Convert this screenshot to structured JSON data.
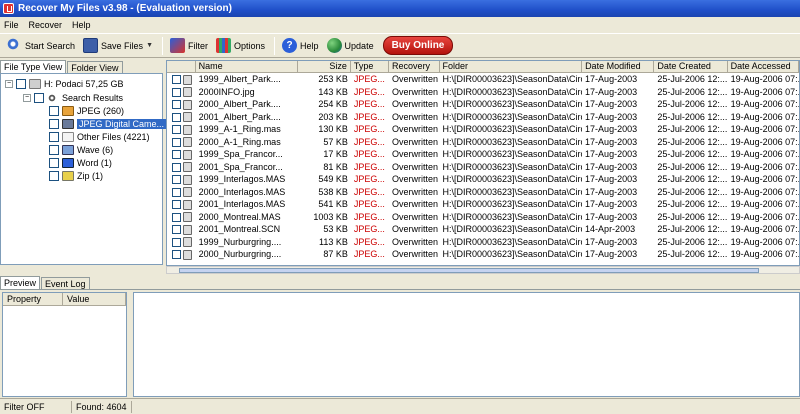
{
  "window": {
    "title": "Recover My Files v3.98  -  (Evaluation version)"
  },
  "menu": [
    "File",
    "Recover",
    "Help"
  ],
  "toolbar": {
    "start_search": "Start Search",
    "save_files": "Save Files",
    "filter": "Filter",
    "options": "Options",
    "help": "Help",
    "update": "Update",
    "buy_online": "Buy Online"
  },
  "left_tabs": [
    "File Type View",
    "Folder View"
  ],
  "tree": {
    "drive": "H: Podaci  57,25 GB",
    "search_results": "Search Results",
    "items": [
      "JPEG (260)",
      "JPEG Digital Came...",
      "Other Files (4221)",
      "Wave (6)",
      "Word (1)",
      "Zip (1)"
    ]
  },
  "list": {
    "columns": [
      "Name",
      "Size",
      "Type",
      "Recovery",
      "Folder",
      "Date Modified",
      "Date Created",
      "Date Accessed"
    ],
    "rows": [
      [
        "1999_Albert_Park....",
        "253 KB",
        "JPEG...",
        "Overwritten",
        "H:\\[DIR00003623]\\SeasonData\\Circ...",
        "17-Aug-2003",
        "25-Jul-2006  12:...",
        "19-Aug-2006  07:..."
      ],
      [
        "2000INFO.jpg",
        "143 KB",
        "JPEG...",
        "Overwritten",
        "H:\\[DIR00003623]\\SeasonData\\Circ...",
        "17-Aug-2003",
        "25-Jul-2006  12:...",
        "19-Aug-2006  07:..."
      ],
      [
        "2000_Albert_Park....",
        "254 KB",
        "JPEG...",
        "Overwritten",
        "H:\\[DIR00003623]\\SeasonData\\Circ...",
        "17-Aug-2003",
        "25-Jul-2006  12:...",
        "19-Aug-2006  07:..."
      ],
      [
        "2001_Albert_Park....",
        "203 KB",
        "JPEG...",
        "Overwritten",
        "H:\\[DIR00003623]\\SeasonData\\Circ...",
        "17-Aug-2003",
        "25-Jul-2006  12:...",
        "19-Aug-2006  07:..."
      ],
      [
        "1999_A-1_Ring.mas",
        "130 KB",
        "JPEG...",
        "Overwritten",
        "H:\\[DIR00003623]\\SeasonData\\Circ...",
        "17-Aug-2003",
        "25-Jul-2006  12:...",
        "19-Aug-2006  07:..."
      ],
      [
        "2000_A-1_Ring.mas",
        "57 KB",
        "JPEG...",
        "Overwritten",
        "H:\\[DIR00003623]\\SeasonData\\Circ...",
        "17-Aug-2003",
        "25-Jul-2006  12:...",
        "19-Aug-2006  07:..."
      ],
      [
        "1999_Spa_Francor...",
        "17 KB",
        "JPEG...",
        "Overwritten",
        "H:\\[DIR00003623]\\SeasonData\\Circ...",
        "17-Aug-2003",
        "25-Jul-2006  12:...",
        "19-Aug-2006  07:..."
      ],
      [
        "2001_Spa_Francor...",
        "81 KB",
        "JPEG...",
        "Overwritten",
        "H:\\[DIR00003623]\\SeasonData\\Circ...",
        "17-Aug-2003",
        "25-Jul-2006  12:...",
        "19-Aug-2006  07:..."
      ],
      [
        "1999_Interlagos.MAS",
        "549 KB",
        "JPEG...",
        "Overwritten",
        "H:\\[DIR00003623]\\SeasonData\\Circ...",
        "17-Aug-2003",
        "25-Jul-2006  12:...",
        "19-Aug-2006  07:..."
      ],
      [
        "2000_Interlagos.MAS",
        "538 KB",
        "JPEG...",
        "Overwritten",
        "H:\\[DIR00003623]\\SeasonData\\Circ...",
        "17-Aug-2003",
        "25-Jul-2006  12:...",
        "19-Aug-2006  07:..."
      ],
      [
        "2001_Interlagos.MAS",
        "541 KB",
        "JPEG...",
        "Overwritten",
        "H:\\[DIR00003623]\\SeasonData\\Circ...",
        "17-Aug-2003",
        "25-Jul-2006  12:...",
        "19-Aug-2006  07:..."
      ],
      [
        "2000_Montreal.MAS",
        "1003 KB",
        "JPEG...",
        "Overwritten",
        "H:\\[DIR00003623]\\SeasonData\\Circ...",
        "17-Aug-2003",
        "25-Jul-2006  12:...",
        "19-Aug-2006  07:..."
      ],
      [
        "2001_Montreal.SCN",
        "53 KB",
        "JPEG...",
        "Overwritten",
        "H:\\[DIR00003623]\\SeasonData\\Circ...",
        "14-Apr-2003",
        "25-Jul-2006  12:...",
        "19-Aug-2006  07:..."
      ],
      [
        "1999_Nurburgring....",
        "113 KB",
        "JPEG...",
        "Overwritten",
        "H:\\[DIR00003623]\\SeasonData\\Circ...",
        "17-Aug-2003",
        "25-Jul-2006  12:...",
        "19-Aug-2006  07:..."
      ],
      [
        "2000_Nurburgring....",
        "87 KB",
        "JPEG...",
        "Overwritten",
        "H:\\[DIR00003623]\\SeasonData\\Circ...",
        "17-Aug-2003",
        "25-Jul-2006  12:...",
        "19-Aug-2006  07:..."
      ]
    ]
  },
  "bottom_tabs": [
    "Preview",
    "Event Log"
  ],
  "properties": {
    "columns": [
      "Property",
      "Value"
    ]
  },
  "status": {
    "filter": "Filter OFF",
    "found": "Found: 4604"
  },
  "colors": {
    "title_bar": "#1f4fc8",
    "selection": "#316ac5",
    "type_text": "#cc0000",
    "buy_button": "#c8201a"
  },
  "icons": {
    "app": "app-icon",
    "start_search": "magnifier-icon",
    "save_files": "save-icon",
    "filter": "funnel-icon",
    "options": "options-icon",
    "help": "help-icon",
    "update": "globe-icon",
    "drive": "drive-icon",
    "search": "search-icon"
  }
}
